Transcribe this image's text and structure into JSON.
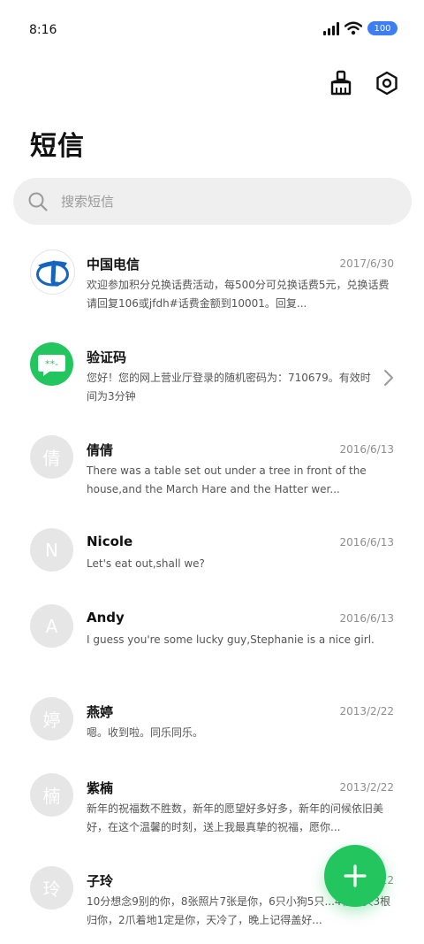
{
  "status_bar": {
    "time": "8:16",
    "battery": "100",
    "accent": "#3d7ef5"
  },
  "header": {
    "title": "短信",
    "actions": [
      {
        "icon": "broom-icon"
      },
      {
        "icon": "settings-icon"
      }
    ]
  },
  "search": {
    "placeholder": "搜索短信"
  },
  "messages": [
    {
      "sender": "中国电信",
      "date": "2017/6/30",
      "preview": "欢迎参加积分兑换话费活动，每500分可兑换话费5元，兑换话费请回复106或jfdh#话费金额到10001。回复...",
      "avatar_type": "logo",
      "avatar_icon": "china-telecom-logo"
    },
    {
      "sender": "验证码",
      "date": "",
      "preview": "您好！您的网上营业厅登录的随机密码为：710679。有效时间为3分钟",
      "avatar_type": "icon",
      "avatar_icon": "verification-code-icon",
      "avatar_color": "#22c55e"
    },
    {
      "sender": "倩倩",
      "date": "2016/6/13",
      "preview": "There was a table set out under a tree in front of the house,and the March Hare and the Hatter wer...",
      "avatar_text": "倩"
    },
    {
      "sender": "Nicole",
      "date": "2016/6/13",
      "preview": "Let's eat out,shall we?",
      "avatar_text": "N"
    },
    {
      "sender": "Andy",
      "date": "2016/6/13",
      "preview": "I guess you're some lucky guy,Stephanie is a nice girl.",
      "avatar_text": "A"
    },
    {
      "sender": "燕婷",
      "date": "2013/2/22",
      "preview": "嗯。收到啦。同乐同乐。",
      "avatar_text": "婷"
    },
    {
      "sender": "紫楠",
      "date": "2013/2/22",
      "preview": "新年的祝福数不胜数，新年的愿望好多好多，新年的问候依旧美好，在这个温馨的时刻，送上我最真挚的祝福，愿你...",
      "avatar_text": "楠"
    },
    {
      "sender": "子玲",
      "date": "2013/2/22",
      "preview": "10分想念9别的你，8张照片7张是你，6只小狗5只...4根骨头3根归你，2爪着地1定是你，天冷了，晚上记得盖好...",
      "avatar_text": "玲"
    }
  ],
  "fab": {
    "icon": "plus-icon",
    "color": "#22c55e"
  }
}
